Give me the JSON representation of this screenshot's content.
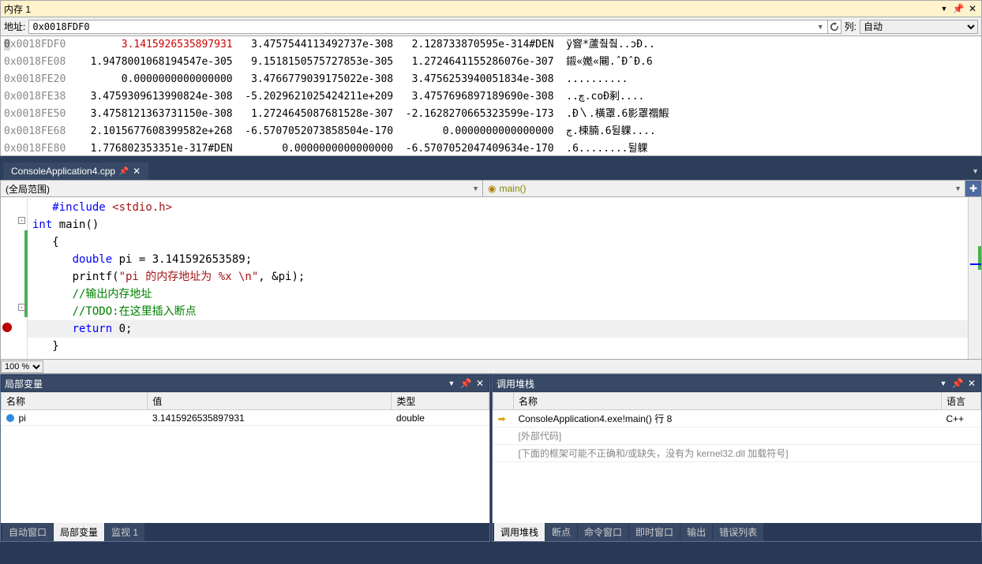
{
  "memory_panel": {
    "title": "内存 1",
    "address_label": "地址:",
    "address_value": "0x0018FDF0",
    "columns_label": "列:",
    "columns_value": "自动",
    "rows": [
      {
        "addr": "0x0018FDF0",
        "v1": "3.1415926535897931",
        "v2": "3.4757544113492737e-308",
        "v3": "2.128733870595e-314#DEN",
        "ascii": "ÿ窨*蘆췈췈..ɔÐ..",
        "pi": true,
        "hiFirst": true
      },
      {
        "addr": "0x0018FE08",
        "v1": "1.9478001068194547e-305",
        "v2": "9.1518150575727853e-305",
        "v3": "1.2724641155286076e-307",
        "ascii": "鎩«嬔«闀.ˆÐˆÐ.6"
      },
      {
        "addr": "0x0018FE20",
        "v1": "0.0000000000000000",
        "v2": "3.4766779039175022e-308",
        "v3": "3.4756253940051834e-308",
        "ascii": ".........."
      },
      {
        "addr": "0x0018FE38",
        "v1": "3.4759309613990824e-308",
        "v2": "-5.2029621025424211e+209",
        "v3": "3.4757696897189690e-308",
        "ascii": "..ڇ.coÐ剢...."
      },
      {
        "addr": "0x0018FE50",
        "v1": "3.4758121363731150e-308",
        "v2": "1.2724645087681528e-307",
        "v3": "-2.1628270665323599e-173",
        "ascii": ".Ð〵.橫罩.6影罩禤鰕"
      },
      {
        "addr": "0x0018FE68",
        "v1": "2.1015677608399582e+268",
        "v2": "-6.5707052073858504e-170",
        "v3": "0.0000000000000000",
        "ascii": "ڄ.楝腩.6뒬躶...."
      },
      {
        "addr": "0x0018FE80",
        "v1": "1.776802353351e-317#DEN",
        "v2": "0.0000000000000000",
        "v3": "-6.5707052047409634e-170",
        "ascii": ".6........뒬躶"
      }
    ]
  },
  "editor": {
    "file_tab": "ConsoleApplication4.cpp",
    "scope_global": "(全局范围)",
    "scope_method": "main()",
    "zoom": "100 %",
    "lines": [
      {
        "t": "inc",
        "c": "   #include <stdio.h>"
      },
      {
        "t": "sig",
        "c": "int main()"
      },
      {
        "t": "plain",
        "c": "   {"
      },
      {
        "t": "decl",
        "c": "      double pi = 3.141592653589;"
      },
      {
        "t": "print",
        "c": "      printf(\"pi 的内存地址为 %x \\n\", &pi);"
      },
      {
        "t": "com",
        "c": "      //输出内存地址"
      },
      {
        "t": "com",
        "c": "      //TODO:在这里插入断点"
      },
      {
        "t": "ret",
        "c": "      return 0;"
      },
      {
        "t": "plain",
        "c": "   }"
      }
    ]
  },
  "locals": {
    "title": "局部变量",
    "cols": {
      "name": "名称",
      "value": "值",
      "type": "类型"
    },
    "rows": [
      {
        "name": "pi",
        "value": "3.1415926535897931",
        "type": "double"
      }
    ],
    "tabs": [
      "自动窗口",
      "局部变量",
      "监视 1"
    ],
    "active_tab": 1
  },
  "callstack": {
    "title": "调用堆栈",
    "cols": {
      "name": "名称",
      "lang": "语言"
    },
    "rows": [
      {
        "name": "ConsoleApplication4.exe!main() 行 8",
        "lang": "C++",
        "active": true
      },
      {
        "name": "[外部代码]",
        "dim": true
      },
      {
        "name": "[下面的框架可能不正确和/或缺失，没有为 kernel32.dll 加载符号]",
        "dim": true
      }
    ],
    "tabs": [
      "调用堆栈",
      "断点",
      "命令窗口",
      "即时窗口",
      "输出",
      "错误列表"
    ],
    "active_tab": 0
  }
}
